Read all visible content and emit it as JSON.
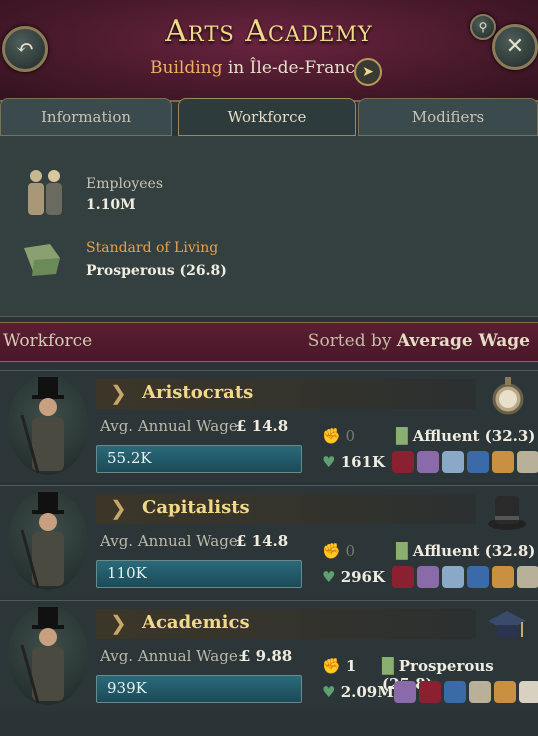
{
  "header": {
    "title": "Arts Academy",
    "subtitle_type": "Building",
    "subtitle_in": "in",
    "subtitle_location": "Île-de-France"
  },
  "tabs": [
    {
      "label": "Information"
    },
    {
      "label": "Workforce"
    },
    {
      "label": "Modifiers"
    }
  ],
  "summary": {
    "employees_label": "Employees",
    "employees_value": "1.10M",
    "sol_label": "Standard of Living",
    "sol_value": "Prosperous (26.8)"
  },
  "workforce": {
    "title": "Workforce",
    "sorted_prefix": "Sorted by",
    "sorted_value": "Average Wage"
  },
  "rows": [
    {
      "name": "Aristocrats",
      "wage_label": "Avg. Annual Wage:",
      "wage_value": "14.8",
      "count": "55.2K",
      "radicals": "0",
      "loyalists": "161K",
      "sol": "Affluent (32.3)"
    },
    {
      "name": "Capitalists",
      "wage_label": "Avg. Annual Wage:",
      "wage_value": "14.8",
      "count": "110K",
      "radicals": "0",
      "loyalists": "296K",
      "sol": "Affluent (32.8)"
    },
    {
      "name": "Academics",
      "wage_label": "Avg. Annual Wage:",
      "wage_value": "9.88",
      "count": "939K",
      "radicals": "1",
      "loyalists": "2.09M",
      "sol": "Prosperous (25.8)"
    }
  ],
  "currency_symbol": "£",
  "colors": {
    "accent_gold": "#f2d98a",
    "header": "#4a1a2c",
    "bar": "#2a6a7a"
  }
}
